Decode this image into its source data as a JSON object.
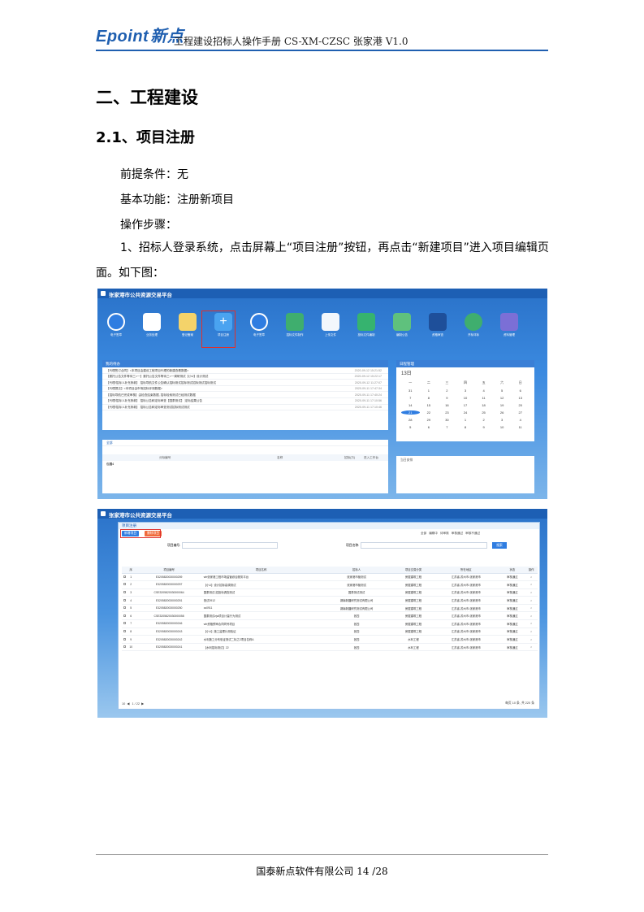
{
  "header": {
    "logo_en": "Epoint",
    "logo_cn": "新点",
    "doc_title": "工程建设招标人操作手册 CS-XM-CZSC 张家港 V1.0"
  },
  "section": {
    "h1": "二、工程建设",
    "h2": "2.1、项目注册"
  },
  "body": {
    "prereq": "前提条件：无",
    "func": "基本功能：注册新项目",
    "steps": "操作步骤：",
    "step1": "1、招标人登录系统，点击屏幕上“项目注册”按钮，再点击“新建项目”进入项目编辑页面。如下图："
  },
  "screenshot1": {
    "platform_title": "张家港市公共资源交易平台",
    "icons": [
      {
        "label": "电子签章",
        "color": "#2f7de1",
        "icon": "paper-plane-icon"
      },
      {
        "label": "业务处理",
        "color": "#ffffff",
        "icon": "document-icon"
      },
      {
        "label": "登记备案",
        "color": "#ffffff",
        "icon": "folder-icon"
      },
      {
        "label": "项目注册",
        "color": "#4aa3f0",
        "icon": "plus-icon"
      },
      {
        "label": "电子签章",
        "color": "#2f7de1",
        "icon": "paper-plane-icon"
      },
      {
        "label": "招标文件制作",
        "color": "#ffffff",
        "icon": "document-green-icon"
      },
      {
        "label": "上传文件",
        "color": "#ffffff",
        "icon": "upload-icon"
      },
      {
        "label": "投标文件编制",
        "color": "#ffffff",
        "icon": "question-icon"
      },
      {
        "label": "编制公告",
        "color": "#ffffff",
        "icon": "form-icon"
      },
      {
        "label": "资格审查",
        "color": "#ffffff",
        "icon": "pen-icon"
      },
      {
        "label": "开标评标",
        "color": "#ffffff",
        "icon": "gavel-icon"
      },
      {
        "label": "资料管理",
        "color": "#ffffff",
        "icon": "edit-icon"
      }
    ],
    "todo_title": "我的待办",
    "todo_rows": [
      {
        "text": "【代理签订合同】<本项目由建设工程项目代理的新建查看数据>",
        "date": "2020-09-12 15:21:52"
      },
      {
        "text": "【委托公告文件等待三>一】委托公告文件等待三>一调研测试【小U】设计测试",
        "date": "2020-09-12 15:22:17"
      },
      {
        "text": "【代理/招标人补充条款】 招标导航文件公告确认招标测试招标测试招标测试招标测试",
        "date": "2020-09-12 11:27:07"
      },
      {
        "text": "【代理提交】<本项目由市场招标评测数据>",
        "date": "2020-09-11 17:47:34"
      },
      {
        "text": "【招标导航已完成审核】由检查结束数据, 招标检索测试已经测试数据",
        "date": "2020-09-11 17:40:24"
      },
      {
        "text": "【代理/招标人补充条款】 招标公告和定标审查【国泰测试】 定标结果公告",
        "date": "2020-09-11 17:10:56"
      },
      {
        "text": "【代理/招标人补充条款】 招标公告和定标审查测试招标测试测试",
        "date": "2020-09-11 17:10:46"
      }
    ],
    "calendar_title": "日程管理",
    "calendar_month": "13日",
    "calendar_days": [
      "一",
      "二",
      "三",
      "四",
      "五",
      "六",
      "日",
      "31",
      "1",
      "2",
      "3",
      "4",
      "5",
      "6",
      "7",
      "8",
      "9",
      "10",
      "11",
      "12",
      "13",
      "14",
      "15",
      "16",
      "17",
      "18",
      "19",
      "20",
      "21",
      "22",
      "23",
      "24",
      "25",
      "26",
      "27",
      "28",
      "29",
      "30",
      "1",
      "2",
      "3",
      "4",
      "5",
      "6",
      "7",
      "8",
      "9",
      "10",
      "11"
    ],
    "filter_label": "全部",
    "table_header": [
      "分标编号",
      "名称",
      "招标(万)",
      "进入工作台"
    ],
    "table_first": "包圆4",
    "reminder_title": "当日安排"
  },
  "screenshot2": {
    "modal_title": "项目注册",
    "btn_new": "新增项目",
    "btn_delete": "删除项目",
    "field_code": "项目编号:",
    "field_name": "项目名称:",
    "btn_search": "搜索",
    "filters": [
      "全部",
      "编辑中",
      "待审核",
      "审核通过",
      "审核不通过"
    ],
    "columns": [
      "序",
      "项目编号",
      "项目名称",
      "招标人",
      "项目交易分类",
      "所在地区",
      "状态",
      "操作"
    ],
    "rows": [
      [
        "1",
        "E3205820030000259",
        "wfr张家港工程市场监管综合服务平台",
        "张家港市管测试",
        "房屋建筑工程",
        "江苏省-苏州市-张家港市",
        "审核通过"
      ],
      [
        "2",
        "E3205820030000257",
        "【小U】设计招标高调测试",
        "张家港市管测试",
        "房屋建筑工程",
        "江苏省-苏州市-张家港市",
        "审核通过"
      ],
      [
        "3",
        "CSE3205820030000064",
        "国泰测试-招投标调查测试",
        "国泰测试测试",
        "房屋建筑工程",
        "江苏省-苏州市-张家港市",
        "审核通过"
      ],
      [
        "4",
        "E3205820030000251",
        "测试0912",
        "湖南新疆研究测试有限公司",
        "房屋建筑工程",
        "江苏省-苏州市-张家港市",
        "审核通过"
      ],
      [
        "5",
        "E3205820030000250",
        "cs0911",
        "湖南新疆研究测试有限公司",
        "房屋建筑工程",
        "江苏省-苏州市-张家港市",
        "审核通过"
      ],
      [
        "6",
        "CSE3205820030000058",
        "国泰测试zjw项目计量行为测试",
        "张四",
        "房屋建筑工程",
        "江苏省-苏州市-张家港市",
        "审核通过"
      ],
      [
        "7",
        "E3205820030000246",
        "wfr资格预审合同同号项目",
        "张四",
        "房屋建筑工程",
        "江苏省-苏州市-张家港市",
        "审核通过"
      ],
      [
        "8",
        "E3205820030000243",
        "【小U】施工监理片测验证",
        "张四",
        "房屋建筑工程",
        "江苏省-苏州市-张家港市",
        "审核通过"
      ],
      [
        "9",
        "E3205820030000242",
        "水利施工分布验证测试二标之2项目名称A",
        "张四",
        "水利工程",
        "江苏省-苏州市-张家港市",
        "审核通过"
      ],
      [
        "10",
        "E3205820030000241",
        "【水利招标测试】22",
        "张四",
        "水利工程",
        "江苏省-苏州市-张家港市",
        "审核通过"
      ]
    ],
    "pager_size": "10",
    "pager_page": "1",
    "pager_total": "/ 22",
    "pager_info": "每页 10 条, 共 220 条"
  },
  "footer": {
    "company": "国泰新点软件有限公司",
    "page": "14 /28"
  }
}
